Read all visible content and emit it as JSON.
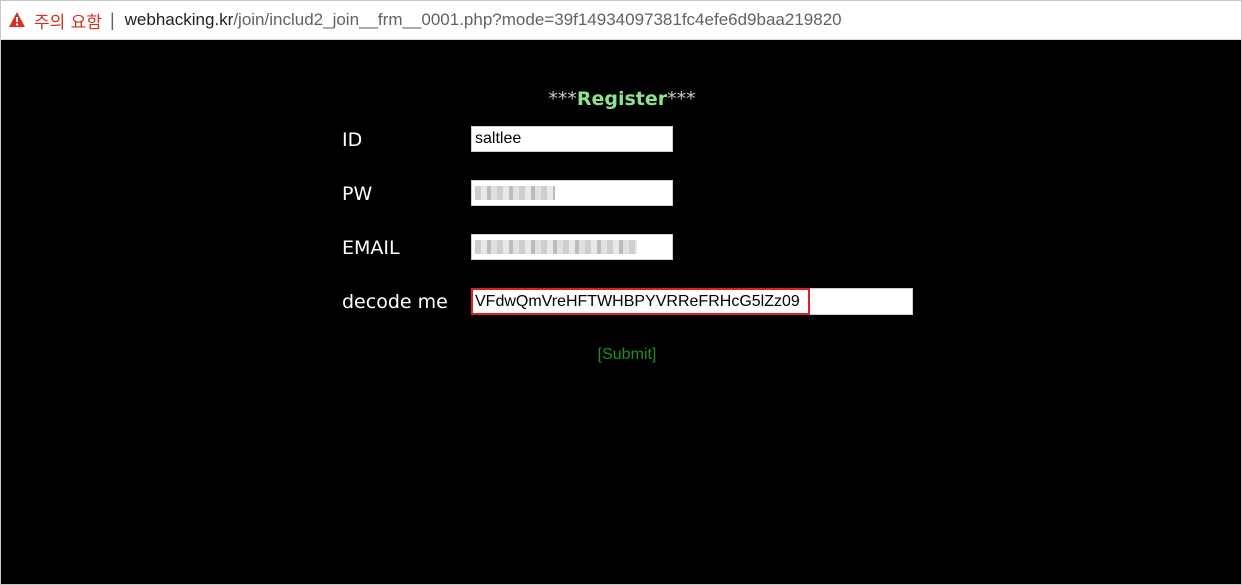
{
  "browser": {
    "security_warning": "주의 요함",
    "separator": "|",
    "url_host": "webhacking.kr",
    "url_path": "/join/includ2_join__frm__0001.php?mode=39f14934097381fc4efe6d9baa219820",
    "warning_color": "#d93025"
  },
  "form": {
    "title_prefix": "***",
    "title_main": "Register",
    "title_suffix": "***",
    "fields": [
      {
        "label": "ID",
        "value": "saltlee"
      },
      {
        "label": "PW",
        "value": ""
      },
      {
        "label": "EMAIL",
        "value": ""
      },
      {
        "label": "decode me",
        "value": "VFdwQmVreHFTWHBPYVRReFRHcG5lZz09"
      }
    ],
    "submit_label": "[Submit]",
    "accent_color": "#8fe38f",
    "submit_color": "#1f8f1f",
    "highlight_color": "#e02020"
  }
}
